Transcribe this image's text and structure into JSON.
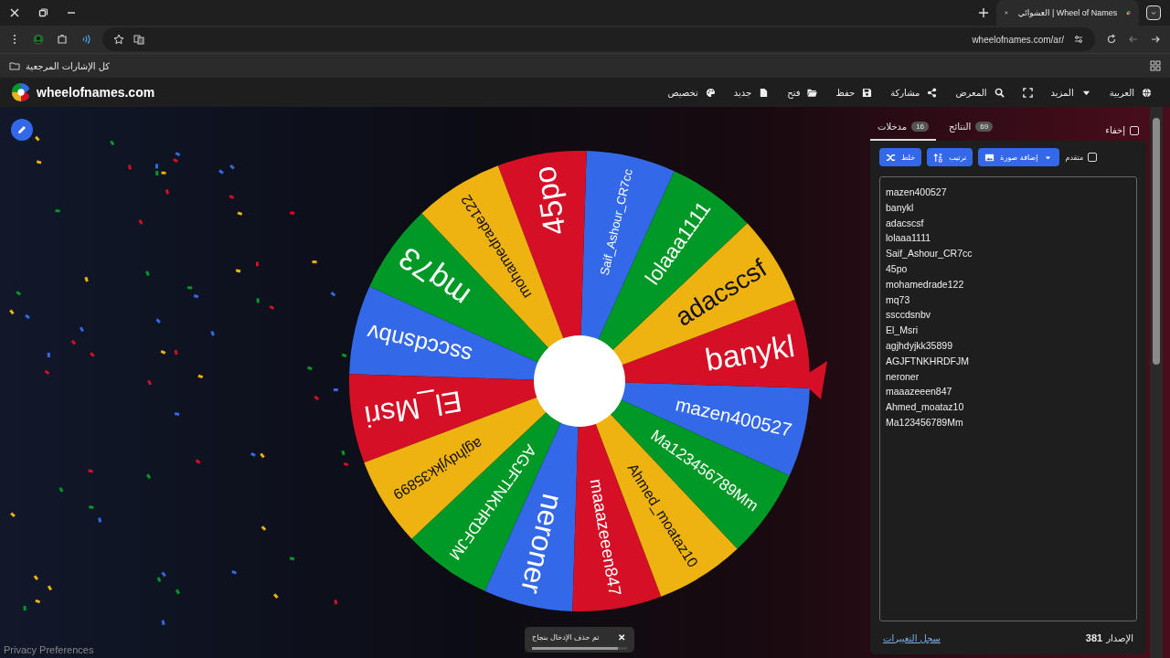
{
  "browser": {
    "tab_title": "العشوائي | Wheel of Names",
    "url": "wheelofnames.com/ar/",
    "bookmarks_label": "كل الإشارات المرجعية"
  },
  "site": {
    "logo_text": "wheelofnames.com",
    "nav": [
      {
        "label": "العربية",
        "kind": "globe"
      },
      {
        "label": "المزيد",
        "kind": "caret"
      },
      {
        "kind": "fullscreen"
      },
      {
        "label": "المعرض",
        "kind": "search"
      },
      {
        "label": "مشاركة",
        "kind": "share"
      },
      {
        "label": "حفظ",
        "kind": "save"
      },
      {
        "label": "فتح",
        "kind": "folder"
      },
      {
        "label": "جديد",
        "kind": "file"
      },
      {
        "label": "تخصيص",
        "kind": "palette"
      }
    ]
  },
  "wheel": {
    "segments": [
      {
        "label": "mazen400527",
        "color": "#3369e8"
      },
      {
        "label": "banykl",
        "color": "#d50f25"
      },
      {
        "label": "adacscsf",
        "color": "#eeb211"
      },
      {
        "label": "lolaaa1111",
        "color": "#009925"
      },
      {
        "label": "Saif_Ashour_CR7cc",
        "color": "#3369e8"
      },
      {
        "label": "45po",
        "color": "#d50f25"
      },
      {
        "label": "mohamedrade122",
        "color": "#eeb211"
      },
      {
        "label": "mq73",
        "color": "#009925"
      },
      {
        "label": "ssccdsnbv",
        "color": "#3369e8"
      },
      {
        "label": "El_Msri",
        "color": "#d50f25"
      },
      {
        "label": "agjhdyjkk35899",
        "color": "#eeb211"
      },
      {
        "label": "AGJFTNKHRDFJM",
        "color": "#009925"
      },
      {
        "label": "neroner",
        "color": "#3369e8"
      },
      {
        "label": "maaazeeen847",
        "color": "#d50f25"
      },
      {
        "label": "Ahmed_moataz10",
        "color": "#eeb211"
      },
      {
        "label": "Ma123456789Mm",
        "color": "#009925"
      }
    ]
  },
  "panel": {
    "hide": {
      "label": "إخفاء",
      "checked": false
    },
    "tabs": [
      {
        "label": "النتائج",
        "count": "69",
        "selected": false
      },
      {
        "label": "مدخلات",
        "count": "16",
        "selected": true
      }
    ],
    "toolbar": [
      {
        "label": "إضافة صورة",
        "kind": "image"
      },
      {
        "label": "ترتيب",
        "kind": "sort"
      },
      {
        "label": "خلط",
        "kind": "shuffle"
      }
    ],
    "advanced": {
      "label": "متقدم",
      "checked": false
    },
    "entries": [
      "mazen400527",
      "banykl",
      "adacscsf",
      "lolaaa1111",
      "Saif_Ashour_CR7cc",
      "45po",
      "mohamedrade122",
      "mq73",
      "ssccdsnbv",
      "El_Msri",
      "agjhdyjkk35899",
      "AGJFTNKHRDFJM",
      "neroner",
      "maaazeeen847",
      "Ahmed_moataz10",
      "Ma123456789Mm"
    ],
    "version_label": "الإصدار",
    "version": "381",
    "changelog_link": "سجل التغييرات"
  },
  "toast": {
    "message": "تم حذف الإدخال بنجاح",
    "close": "✕",
    "level": 0.9
  },
  "privacy": "Privacy Preferences"
}
